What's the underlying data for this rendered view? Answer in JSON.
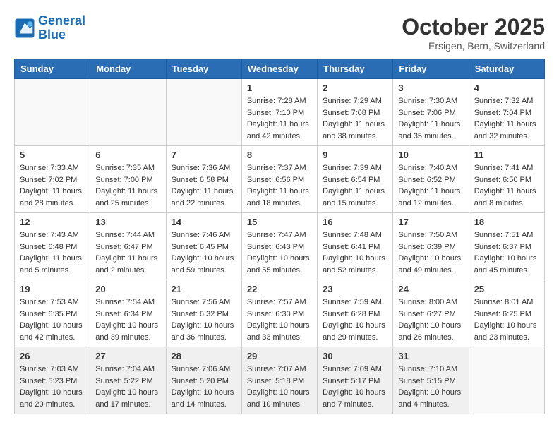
{
  "header": {
    "logo_line1": "General",
    "logo_line2": "Blue",
    "month": "October 2025",
    "location": "Ersigen, Bern, Switzerland"
  },
  "days_of_week": [
    "Sunday",
    "Monday",
    "Tuesday",
    "Wednesday",
    "Thursday",
    "Friday",
    "Saturday"
  ],
  "weeks": [
    [
      {
        "day": "",
        "info": ""
      },
      {
        "day": "",
        "info": ""
      },
      {
        "day": "",
        "info": ""
      },
      {
        "day": "1",
        "info": "Sunrise: 7:28 AM\nSunset: 7:10 PM\nDaylight: 11 hours and 42 minutes."
      },
      {
        "day": "2",
        "info": "Sunrise: 7:29 AM\nSunset: 7:08 PM\nDaylight: 11 hours and 38 minutes."
      },
      {
        "day": "3",
        "info": "Sunrise: 7:30 AM\nSunset: 7:06 PM\nDaylight: 11 hours and 35 minutes."
      },
      {
        "day": "4",
        "info": "Sunrise: 7:32 AM\nSunset: 7:04 PM\nDaylight: 11 hours and 32 minutes."
      }
    ],
    [
      {
        "day": "5",
        "info": "Sunrise: 7:33 AM\nSunset: 7:02 PM\nDaylight: 11 hours and 28 minutes."
      },
      {
        "day": "6",
        "info": "Sunrise: 7:35 AM\nSunset: 7:00 PM\nDaylight: 11 hours and 25 minutes."
      },
      {
        "day": "7",
        "info": "Sunrise: 7:36 AM\nSunset: 6:58 PM\nDaylight: 11 hours and 22 minutes."
      },
      {
        "day": "8",
        "info": "Sunrise: 7:37 AM\nSunset: 6:56 PM\nDaylight: 11 hours and 18 minutes."
      },
      {
        "day": "9",
        "info": "Sunrise: 7:39 AM\nSunset: 6:54 PM\nDaylight: 11 hours and 15 minutes."
      },
      {
        "day": "10",
        "info": "Sunrise: 7:40 AM\nSunset: 6:52 PM\nDaylight: 11 hours and 12 minutes."
      },
      {
        "day": "11",
        "info": "Sunrise: 7:41 AM\nSunset: 6:50 PM\nDaylight: 11 hours and 8 minutes."
      }
    ],
    [
      {
        "day": "12",
        "info": "Sunrise: 7:43 AM\nSunset: 6:48 PM\nDaylight: 11 hours and 5 minutes."
      },
      {
        "day": "13",
        "info": "Sunrise: 7:44 AM\nSunset: 6:47 PM\nDaylight: 11 hours and 2 minutes."
      },
      {
        "day": "14",
        "info": "Sunrise: 7:46 AM\nSunset: 6:45 PM\nDaylight: 10 hours and 59 minutes."
      },
      {
        "day": "15",
        "info": "Sunrise: 7:47 AM\nSunset: 6:43 PM\nDaylight: 10 hours and 55 minutes."
      },
      {
        "day": "16",
        "info": "Sunrise: 7:48 AM\nSunset: 6:41 PM\nDaylight: 10 hours and 52 minutes."
      },
      {
        "day": "17",
        "info": "Sunrise: 7:50 AM\nSunset: 6:39 PM\nDaylight: 10 hours and 49 minutes."
      },
      {
        "day": "18",
        "info": "Sunrise: 7:51 AM\nSunset: 6:37 PM\nDaylight: 10 hours and 45 minutes."
      }
    ],
    [
      {
        "day": "19",
        "info": "Sunrise: 7:53 AM\nSunset: 6:35 PM\nDaylight: 10 hours and 42 minutes."
      },
      {
        "day": "20",
        "info": "Sunrise: 7:54 AM\nSunset: 6:34 PM\nDaylight: 10 hours and 39 minutes."
      },
      {
        "day": "21",
        "info": "Sunrise: 7:56 AM\nSunset: 6:32 PM\nDaylight: 10 hours and 36 minutes."
      },
      {
        "day": "22",
        "info": "Sunrise: 7:57 AM\nSunset: 6:30 PM\nDaylight: 10 hours and 33 minutes."
      },
      {
        "day": "23",
        "info": "Sunrise: 7:59 AM\nSunset: 6:28 PM\nDaylight: 10 hours and 29 minutes."
      },
      {
        "day": "24",
        "info": "Sunrise: 8:00 AM\nSunset: 6:27 PM\nDaylight: 10 hours and 26 minutes."
      },
      {
        "day": "25",
        "info": "Sunrise: 8:01 AM\nSunset: 6:25 PM\nDaylight: 10 hours and 23 minutes."
      }
    ],
    [
      {
        "day": "26",
        "info": "Sunrise: 7:03 AM\nSunset: 5:23 PM\nDaylight: 10 hours and 20 minutes."
      },
      {
        "day": "27",
        "info": "Sunrise: 7:04 AM\nSunset: 5:22 PM\nDaylight: 10 hours and 17 minutes."
      },
      {
        "day": "28",
        "info": "Sunrise: 7:06 AM\nSunset: 5:20 PM\nDaylight: 10 hours and 14 minutes."
      },
      {
        "day": "29",
        "info": "Sunrise: 7:07 AM\nSunset: 5:18 PM\nDaylight: 10 hours and 10 minutes."
      },
      {
        "day": "30",
        "info": "Sunrise: 7:09 AM\nSunset: 5:17 PM\nDaylight: 10 hours and 7 minutes."
      },
      {
        "day": "31",
        "info": "Sunrise: 7:10 AM\nSunset: 5:15 PM\nDaylight: 10 hours and 4 minutes."
      },
      {
        "day": "",
        "info": ""
      }
    ]
  ]
}
